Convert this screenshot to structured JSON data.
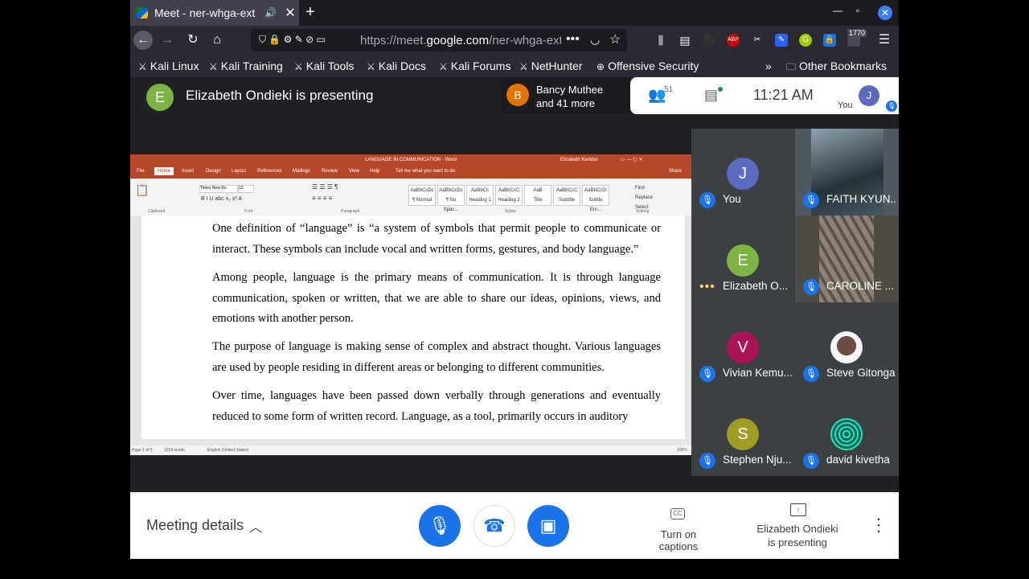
{
  "browser": {
    "tab_title": "Meet - ner-whga-ext",
    "speaker_glyph": "🔊",
    "close_glyph": "✕",
    "new_tab_glyph": "+",
    "url_prefix": "https://meet.",
    "url_domain": "google.com",
    "url_rest": "/ner-whga-ext",
    "url_more": "•••",
    "extension_badge": "1770",
    "bookmarks": [
      "Kali Linux",
      "Kali Training",
      "Kali Tools",
      "Kali Docs",
      "Kali Forums",
      "NetHunter",
      "Offensive Security"
    ],
    "overflow_glyph": "»",
    "other_bookmarks": "Other Bookmarks"
  },
  "meet": {
    "presenter_initial": "E",
    "presenter_text": "Elizabeth Ondieki is presenting",
    "raised_initial": "B",
    "raised_line1": "Bancy Muthee",
    "raised_line2": "and 41 more",
    "people_count": "51",
    "time": "11:21 AM",
    "you_label": "You",
    "you_initial": "J",
    "participants": [
      {
        "name": "You",
        "initial": "J",
        "color": "#5c6bc0"
      },
      {
        "name": "FAITH KYUN...",
        "initial": "",
        "color": "#607d8b"
      },
      {
        "name": "Elizabeth O...",
        "initial": "E",
        "color": "#7cb342"
      },
      {
        "name": "CAROLINE ...",
        "initial": "",
        "color": "#8d6e63"
      },
      {
        "name": "Vivian Kemu...",
        "initial": "V",
        "color": "#ad1457"
      },
      {
        "name": "Steve Gitonga",
        "initial": "",
        "color": "#a1887f"
      },
      {
        "name": "Stephen Nju...",
        "initial": "S",
        "color": "#9e9d24"
      },
      {
        "name": "david kivetha",
        "initial": "",
        "color": "#00695c"
      }
    ],
    "meeting_details": "Meeting details",
    "captions_label": "Turn on captions",
    "presenting_line1": "Elizabeth Ondieki",
    "presenting_line2": "is presenting"
  },
  "word": {
    "title": "LANGUAGE IN COMMUNICATION - Word",
    "user": "Elizabeth Kemboi",
    "tabs": [
      "File",
      "Home",
      "Insert",
      "Design",
      "Layout",
      "References",
      "Mailings",
      "Review",
      "View",
      "Help"
    ],
    "tell_me": "Tell me what you want to do",
    "share": "Share",
    "font_name": "Times New Ro",
    "font_size": "12",
    "groups": [
      "Clipboard",
      "Font",
      "Paragraph",
      "Styles",
      "Editing"
    ],
    "styles": [
      "AaBbCcDc",
      "AaBbCcDc",
      "AaBbCc",
      "AaBbCcC",
      "AaB",
      "AaBbCcC",
      "AaBbCcDi"
    ],
    "style_names": [
      "¶ Normal",
      "¶ No Spac...",
      "Heading 1",
      "Heading 2",
      "Title",
      "Subtitle",
      "Subtle Em..."
    ],
    "editing": [
      "Find",
      "Replace",
      "Select"
    ],
    "paragraphs": [
      "One definition of “language” is “a system of symbols that permit people to communicate or interact. These symbols can include vocal and written forms, gestures, and body language.”",
      "Among people, language is the primary means of communication. It is through language communication, spoken or written, that we are able to share our ideas, opinions, views, and emotions with another person.",
      "The purpose of language is making sense of complex and abstract thought. Various languages are used by people residing in different areas or belonging to different communities.",
      "Over time, languages have been passed down verbally through generations and eventually reduced to some form of written record. Language, as a tool, primarily occurs in auditory"
    ],
    "status_page": "Page 1 of 5",
    "status_words": "1014 words",
    "status_lang": "English (United States)",
    "status_zoom": "100%"
  }
}
